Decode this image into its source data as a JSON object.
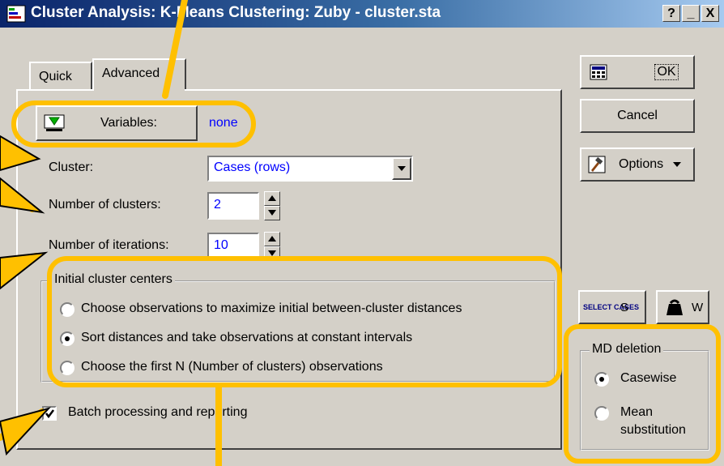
{
  "window": {
    "title": "Cluster Analysis: K-Means Clustering: Zuby - cluster.sta",
    "help_btn": "?",
    "min_btn": "_",
    "close_btn": "X"
  },
  "tabs": [
    {
      "label": "Quick"
    },
    {
      "label": "Advanced"
    }
  ],
  "variables": {
    "button_label": "Variables:",
    "value": "none"
  },
  "cluster": {
    "label": "Cluster:",
    "selected": "Cases (rows)"
  },
  "num_clusters": {
    "label": "Number of clusters:",
    "value": "2"
  },
  "num_iterations": {
    "label": "Number of iterations:",
    "value": "10"
  },
  "initial_centers": {
    "title": "Initial cluster centers",
    "options": [
      {
        "label": "Choose observations to maximize initial between-cluster distances",
        "checked": false
      },
      {
        "label": "Sort distances and take observations at constant intervals",
        "checked": true
      },
      {
        "label": "Choose the first N (Number of clusters) observations",
        "checked": false
      }
    ]
  },
  "batch": {
    "label": "Batch processing and reporting",
    "checked": true
  },
  "side": {
    "ok_label": "OK",
    "cancel_label": "Cancel",
    "options_label": "Options",
    "select_cases_icon_text": "SELECT CASES",
    "select_cases_label": "S",
    "weight_label": "W"
  },
  "md_deletion": {
    "title": "MD deletion",
    "options": [
      {
        "label": "Casewise",
        "checked": true
      },
      {
        "label": "Mean substitution",
        "checked": false
      }
    ]
  },
  "colors": {
    "highlight": "#ffc000",
    "titlebar": "#0a246a",
    "value_text": "#0000ff"
  }
}
